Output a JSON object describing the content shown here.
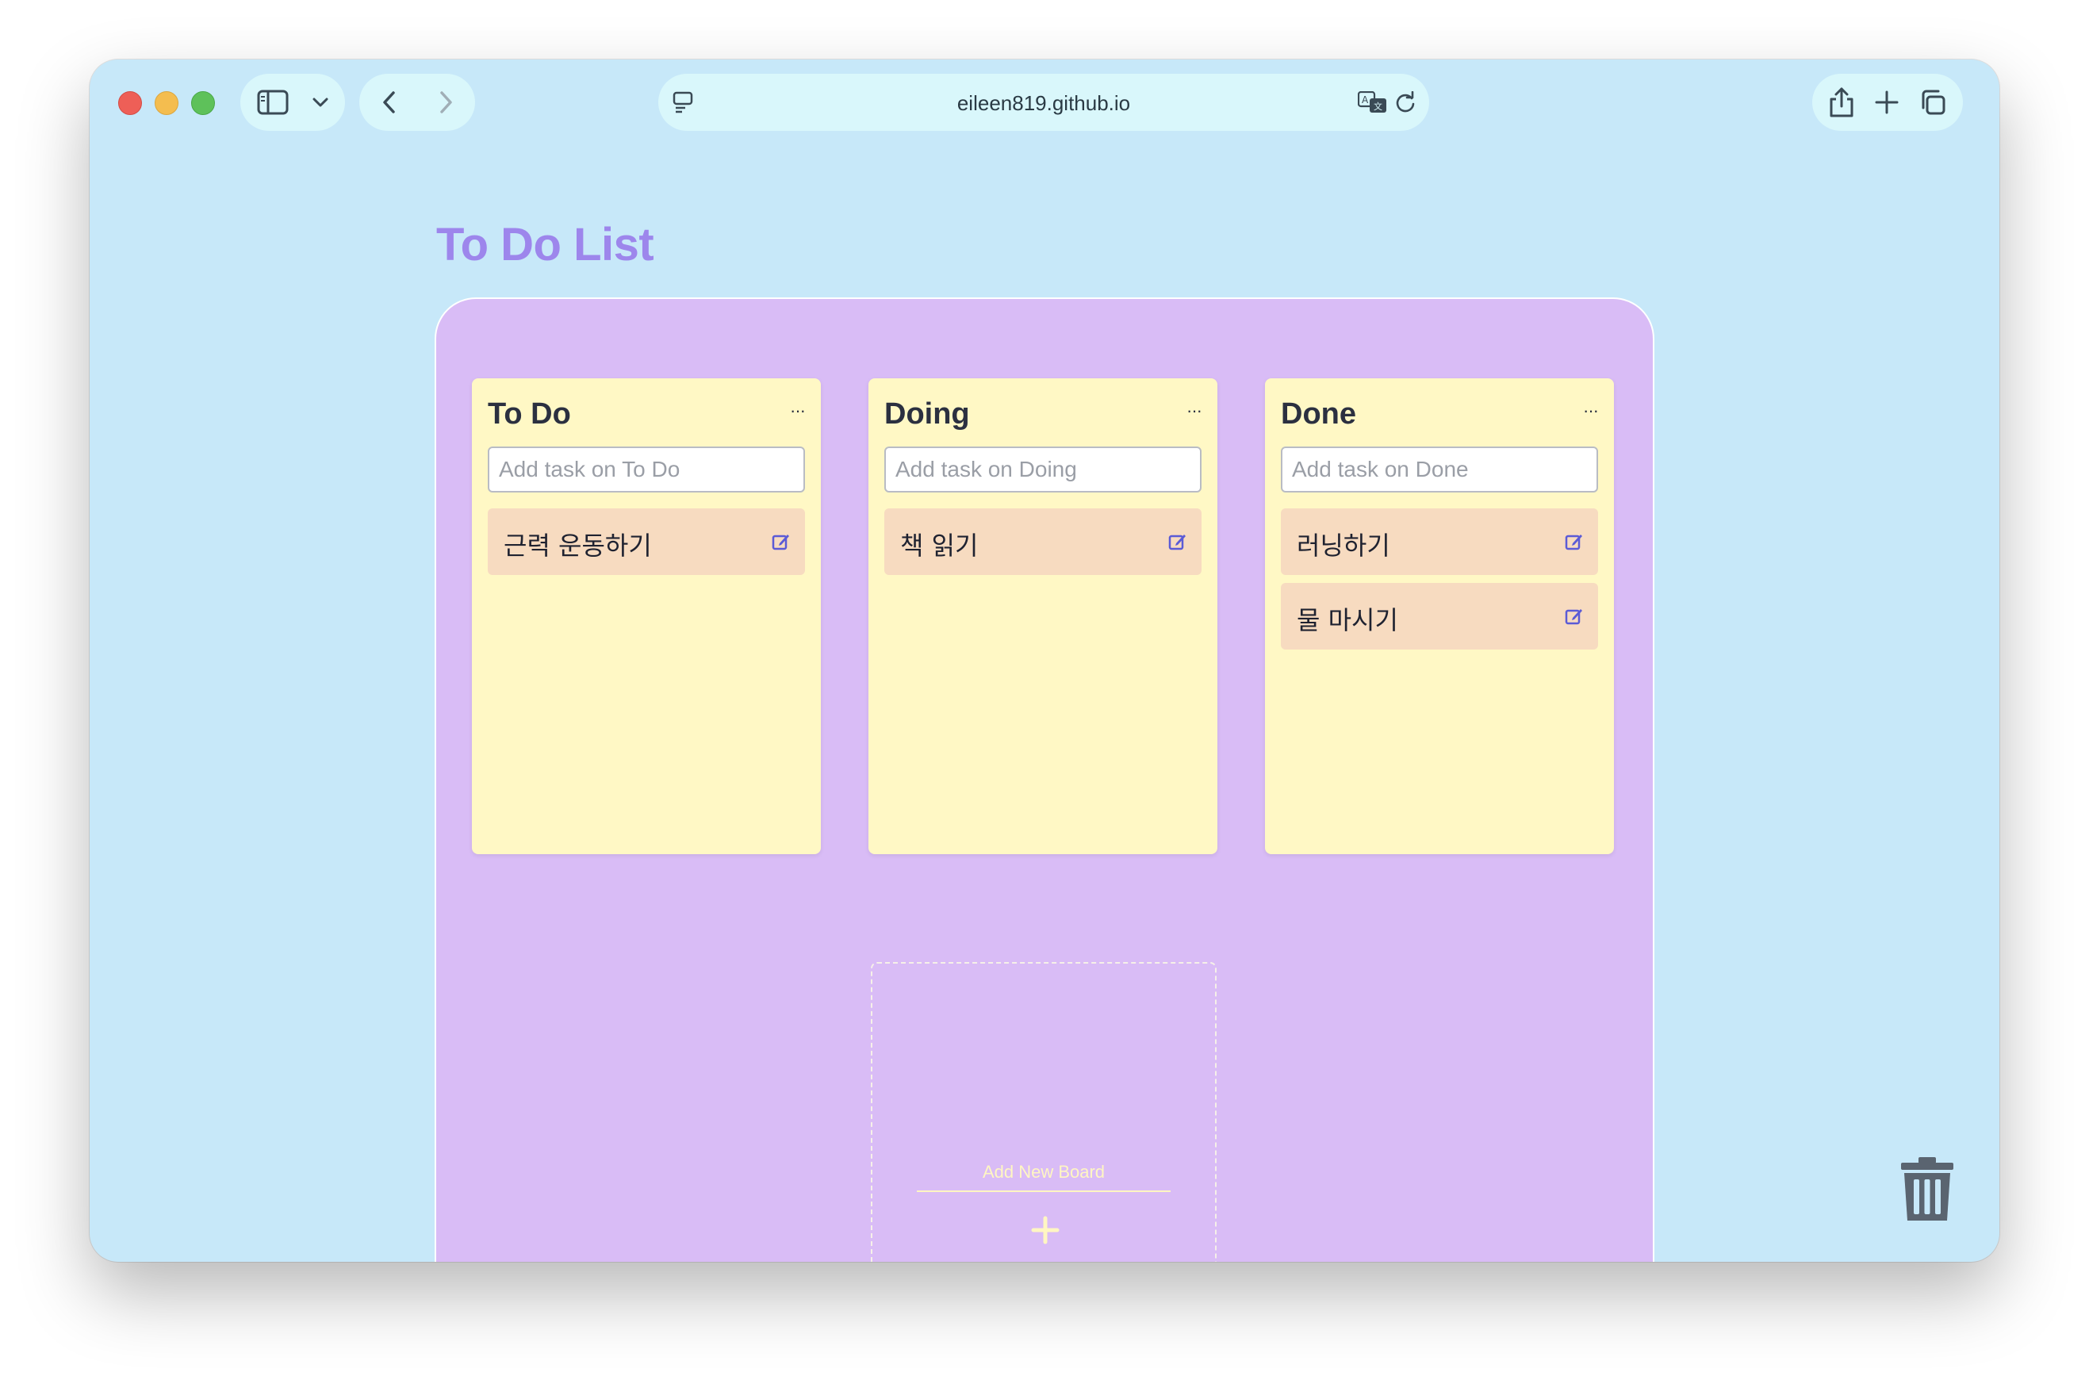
{
  "browser": {
    "url": "eileen819.github.io",
    "icons": [
      "sidebar-toggle-icon",
      "chevron-down-icon",
      "back-arrow-icon",
      "forward-arrow-icon",
      "site-settings-icon",
      "translate-icon",
      "reload-icon",
      "share-icon",
      "new-tab-plus-icon",
      "tab-overview-icon"
    ]
  },
  "page": {
    "title": "To Do List"
  },
  "boards": [
    {
      "title": "To Do",
      "menu": "···",
      "input_placeholder": "Add task on To Do",
      "tasks": [
        {
          "label": "근력 운동하기"
        }
      ]
    },
    {
      "title": "Doing",
      "menu": "···",
      "input_placeholder": "Add task on Doing",
      "tasks": [
        {
          "label": "책 읽기"
        }
      ]
    },
    {
      "title": "Done",
      "menu": "···",
      "input_placeholder": "Add task on Done",
      "tasks": [
        {
          "label": "러닝하기"
        },
        {
          "label": "물 마시기"
        }
      ]
    }
  ],
  "new_board": {
    "label": "Add New Board",
    "icon": "plus-icon"
  },
  "trash": {
    "icon": "trash-icon"
  },
  "colors": {
    "window_bg": "#c7e8f9",
    "title": "#9d86ec",
    "board_area": "#d9bcf6",
    "board": "#fff8c5",
    "task": "#f7dbc0",
    "accent_icon": "#5b5bd6"
  }
}
